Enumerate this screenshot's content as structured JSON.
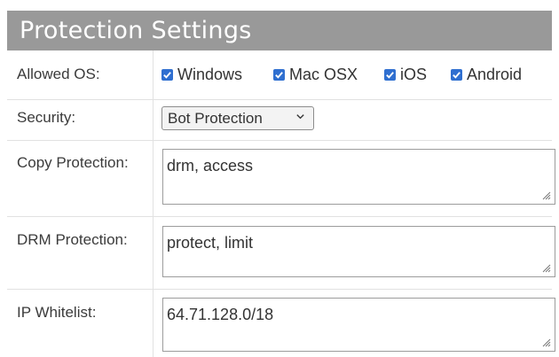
{
  "header": {
    "title": "Protection Settings"
  },
  "rows": {
    "allowed_os": {
      "label": "Allowed OS:",
      "options": [
        {
          "label": "Windows",
          "checked": true
        },
        {
          "label": "Mac OSX",
          "checked": true
        },
        {
          "label": "iOS",
          "checked": true
        },
        {
          "label": "Android",
          "checked": true
        }
      ]
    },
    "security": {
      "label": "Security:",
      "selected": "Bot Protection"
    },
    "copy_protection": {
      "label": "Copy Protection:",
      "value": "drm, access"
    },
    "drm_protection": {
      "label": "DRM Protection:",
      "value": "protect, limit"
    },
    "ip_whitelist": {
      "label": "IP Whitelist:",
      "value": "64.71.128.0/18"
    }
  },
  "colors": {
    "header_bg": "#999999",
    "checkbox": "#2f6fd0",
    "divider": "#e1e1e1"
  }
}
